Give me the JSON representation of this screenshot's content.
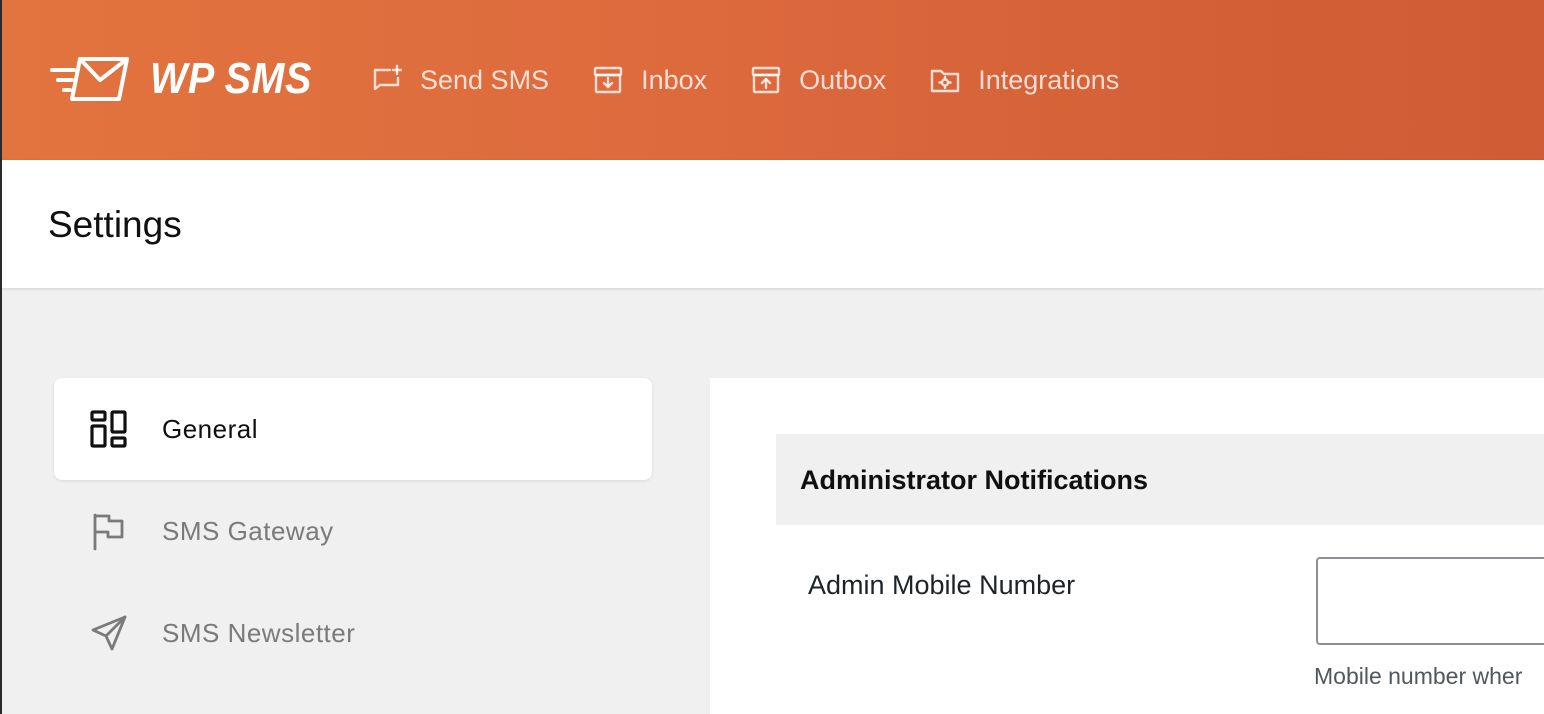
{
  "app": {
    "name": "WP SMS",
    "brand_color_start": "#e2743f",
    "brand_color_end": "#cf5c35"
  },
  "nav": {
    "items": [
      {
        "label": "Send SMS",
        "icon": "message-plus-icon"
      },
      {
        "label": "Inbox",
        "icon": "inbox-icon"
      },
      {
        "label": "Outbox",
        "icon": "outbox-icon"
      },
      {
        "label": "Integrations",
        "icon": "integrations-folder-icon"
      }
    ]
  },
  "page": {
    "title": "Settings"
  },
  "sidebar": {
    "items": [
      {
        "label": "General",
        "icon": "dashboard-grid-icon",
        "active": true
      },
      {
        "label": "SMS Gateway",
        "icon": "flag-icon",
        "active": false
      },
      {
        "label": "SMS Newsletter",
        "icon": "send-arrow-icon",
        "active": false
      }
    ]
  },
  "content": {
    "section_title": "Administrator Notifications",
    "admin_mobile": {
      "label": "Admin Mobile Number",
      "value": "",
      "help": "Mobile number wher"
    }
  }
}
